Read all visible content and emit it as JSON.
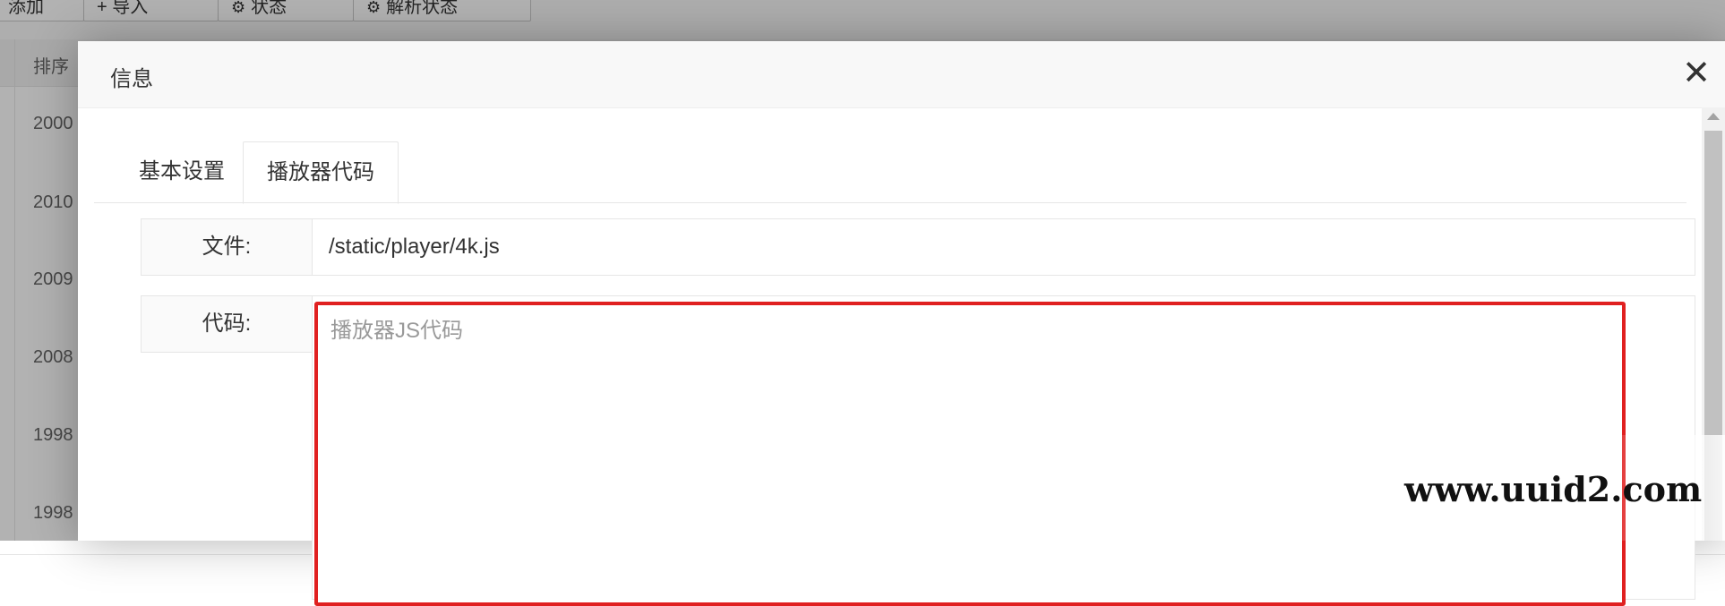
{
  "background": {
    "toolbar_buttons": [
      {
        "label": "添加"
      },
      {
        "label": "+ 导入"
      },
      {
        "label": "状态"
      },
      {
        "label": "解析状态"
      }
    ],
    "table": {
      "column_sort": "排序",
      "rows": [
        "2000",
        "2010",
        "2009",
        "2008",
        "1998",
        "1998"
      ]
    }
  },
  "modal": {
    "title": "信息",
    "close_icon": "close-icon",
    "tabs": [
      {
        "label": "基本设置",
        "active": false
      },
      {
        "label": "播放器代码",
        "active": true
      }
    ],
    "fields": {
      "file": {
        "label": "文件:",
        "value": "/static/player/4k.js"
      },
      "code": {
        "label": "代码:",
        "placeholder": "播放器JS代码",
        "value": ""
      }
    }
  },
  "watermark": "www.uuid2.com",
  "colors": {
    "highlight_border": "#e02020",
    "overlay": "rgba(0,0,0,0.3)",
    "header_bg": "#f8f8f8"
  }
}
